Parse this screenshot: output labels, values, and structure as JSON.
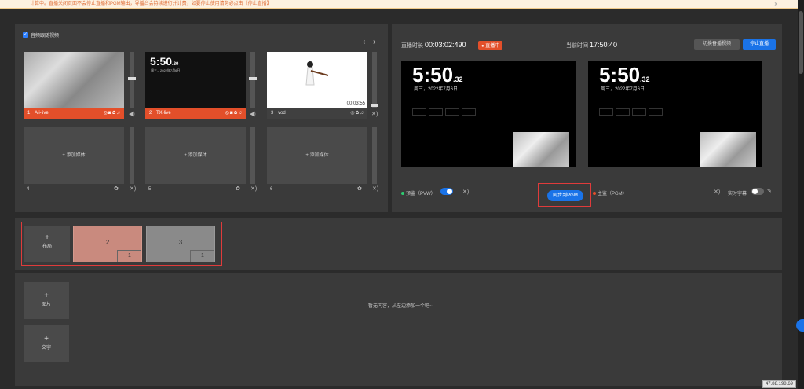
{
  "banner": {
    "text": "计算中。直播关闭页面不会停止直播和PGM输出，导播台会持续进行并计费，如要停止使用请务必点击【停止直播】",
    "close": "x"
  },
  "sources": {
    "mix_label": "音频跟随视频",
    "nav_prev": "‹",
    "nav_next": "›",
    "items": [
      {
        "index": "1",
        "name": "Ali-live",
        "live": true
      },
      {
        "index": "2",
        "name": "TX-live",
        "live": true,
        "clock": "5:50",
        "clock_sec": ".30"
      },
      {
        "index": "3",
        "name": "vod",
        "live": false,
        "duration": "00:03:55"
      }
    ],
    "empty_slots": [
      {
        "index": "4",
        "label": "+ 添加媒体"
      },
      {
        "index": "5",
        "label": "+ 添加媒体"
      },
      {
        "index": "6",
        "label": "+ 添加媒体"
      }
    ]
  },
  "preview": {
    "duration_label": "直播时长",
    "duration_value": "00:03:02:490",
    "live_badge": "● 直播中",
    "time_label": "当前时间",
    "time_value": "17:50:40",
    "switch_btn": "切换备播视频",
    "stop_btn": "停止直播",
    "pvw_clock": "5:50",
    "pvw_sec": ".32",
    "pvw_date": "周三，2022年7月6日",
    "pgm_clock": "5:50",
    "pgm_sec": ".32",
    "pgm_date": "周三，2022年7月6日",
    "pvw_label": "预监（PVW）",
    "sync_btn": "同步到PGM",
    "pgm_label": "主监（PGM）",
    "subtitle_label": "实时字幕",
    "colors": {
      "pvw_dot": "#2ecc71",
      "pgm_dot": "#e34f2a"
    }
  },
  "layout": {
    "add_label": "布局",
    "plus": "+",
    "cards": [
      {
        "main": "2",
        "sub": "1",
        "selected": true
      },
      {
        "main": "3",
        "sub": "1",
        "selected": false
      }
    ]
  },
  "assets": {
    "image_btn": "图片",
    "text_btn": "文字",
    "plus": "+",
    "empty_msg": "暂无内容，从左边添加一个吧~"
  },
  "ip": "47.88.198.69"
}
